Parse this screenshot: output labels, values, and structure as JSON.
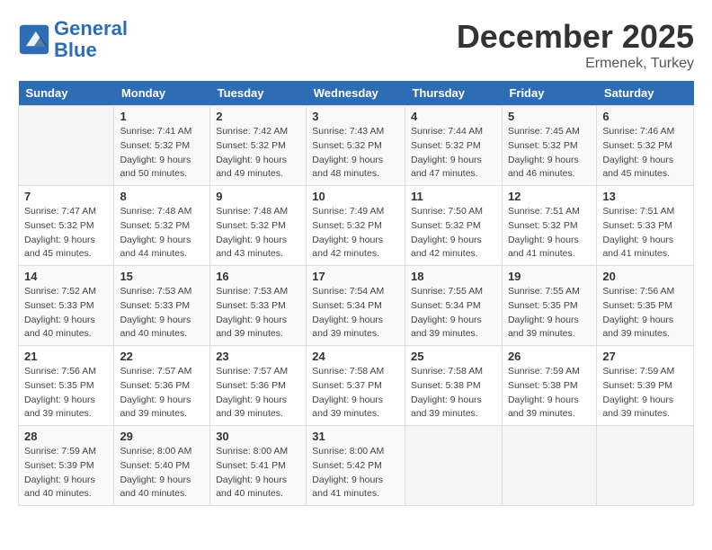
{
  "header": {
    "logo_line1": "General",
    "logo_line2": "Blue",
    "month": "December 2025",
    "location": "Ermenek, Turkey"
  },
  "days_of_week": [
    "Sunday",
    "Monday",
    "Tuesday",
    "Wednesday",
    "Thursday",
    "Friday",
    "Saturday"
  ],
  "weeks": [
    [
      {
        "day": "",
        "info": ""
      },
      {
        "day": "1",
        "info": "Sunrise: 7:41 AM\nSunset: 5:32 PM\nDaylight: 9 hours\nand 50 minutes."
      },
      {
        "day": "2",
        "info": "Sunrise: 7:42 AM\nSunset: 5:32 PM\nDaylight: 9 hours\nand 49 minutes."
      },
      {
        "day": "3",
        "info": "Sunrise: 7:43 AM\nSunset: 5:32 PM\nDaylight: 9 hours\nand 48 minutes."
      },
      {
        "day": "4",
        "info": "Sunrise: 7:44 AM\nSunset: 5:32 PM\nDaylight: 9 hours\nand 47 minutes."
      },
      {
        "day": "5",
        "info": "Sunrise: 7:45 AM\nSunset: 5:32 PM\nDaylight: 9 hours\nand 46 minutes."
      },
      {
        "day": "6",
        "info": "Sunrise: 7:46 AM\nSunset: 5:32 PM\nDaylight: 9 hours\nand 45 minutes."
      }
    ],
    [
      {
        "day": "7",
        "info": "Sunrise: 7:47 AM\nSunset: 5:32 PM\nDaylight: 9 hours\nand 45 minutes."
      },
      {
        "day": "8",
        "info": "Sunrise: 7:48 AM\nSunset: 5:32 PM\nDaylight: 9 hours\nand 44 minutes."
      },
      {
        "day": "9",
        "info": "Sunrise: 7:48 AM\nSunset: 5:32 PM\nDaylight: 9 hours\nand 43 minutes."
      },
      {
        "day": "10",
        "info": "Sunrise: 7:49 AM\nSunset: 5:32 PM\nDaylight: 9 hours\nand 42 minutes."
      },
      {
        "day": "11",
        "info": "Sunrise: 7:50 AM\nSunset: 5:32 PM\nDaylight: 9 hours\nand 42 minutes."
      },
      {
        "day": "12",
        "info": "Sunrise: 7:51 AM\nSunset: 5:32 PM\nDaylight: 9 hours\nand 41 minutes."
      },
      {
        "day": "13",
        "info": "Sunrise: 7:51 AM\nSunset: 5:33 PM\nDaylight: 9 hours\nand 41 minutes."
      }
    ],
    [
      {
        "day": "14",
        "info": "Sunrise: 7:52 AM\nSunset: 5:33 PM\nDaylight: 9 hours\nand 40 minutes."
      },
      {
        "day": "15",
        "info": "Sunrise: 7:53 AM\nSunset: 5:33 PM\nDaylight: 9 hours\nand 40 minutes."
      },
      {
        "day": "16",
        "info": "Sunrise: 7:53 AM\nSunset: 5:33 PM\nDaylight: 9 hours\nand 39 minutes."
      },
      {
        "day": "17",
        "info": "Sunrise: 7:54 AM\nSunset: 5:34 PM\nDaylight: 9 hours\nand 39 minutes."
      },
      {
        "day": "18",
        "info": "Sunrise: 7:55 AM\nSunset: 5:34 PM\nDaylight: 9 hours\nand 39 minutes."
      },
      {
        "day": "19",
        "info": "Sunrise: 7:55 AM\nSunset: 5:35 PM\nDaylight: 9 hours\nand 39 minutes."
      },
      {
        "day": "20",
        "info": "Sunrise: 7:56 AM\nSunset: 5:35 PM\nDaylight: 9 hours\nand 39 minutes."
      }
    ],
    [
      {
        "day": "21",
        "info": "Sunrise: 7:56 AM\nSunset: 5:35 PM\nDaylight: 9 hours\nand 39 minutes."
      },
      {
        "day": "22",
        "info": "Sunrise: 7:57 AM\nSunset: 5:36 PM\nDaylight: 9 hours\nand 39 minutes."
      },
      {
        "day": "23",
        "info": "Sunrise: 7:57 AM\nSunset: 5:36 PM\nDaylight: 9 hours\nand 39 minutes."
      },
      {
        "day": "24",
        "info": "Sunrise: 7:58 AM\nSunset: 5:37 PM\nDaylight: 9 hours\nand 39 minutes."
      },
      {
        "day": "25",
        "info": "Sunrise: 7:58 AM\nSunset: 5:38 PM\nDaylight: 9 hours\nand 39 minutes."
      },
      {
        "day": "26",
        "info": "Sunrise: 7:59 AM\nSunset: 5:38 PM\nDaylight: 9 hours\nand 39 minutes."
      },
      {
        "day": "27",
        "info": "Sunrise: 7:59 AM\nSunset: 5:39 PM\nDaylight: 9 hours\nand 39 minutes."
      }
    ],
    [
      {
        "day": "28",
        "info": "Sunrise: 7:59 AM\nSunset: 5:39 PM\nDaylight: 9 hours\nand 40 minutes."
      },
      {
        "day": "29",
        "info": "Sunrise: 8:00 AM\nSunset: 5:40 PM\nDaylight: 9 hours\nand 40 minutes."
      },
      {
        "day": "30",
        "info": "Sunrise: 8:00 AM\nSunset: 5:41 PM\nDaylight: 9 hours\nand 40 minutes."
      },
      {
        "day": "31",
        "info": "Sunrise: 8:00 AM\nSunset: 5:42 PM\nDaylight: 9 hours\nand 41 minutes."
      },
      {
        "day": "",
        "info": ""
      },
      {
        "day": "",
        "info": ""
      },
      {
        "day": "",
        "info": ""
      }
    ]
  ]
}
